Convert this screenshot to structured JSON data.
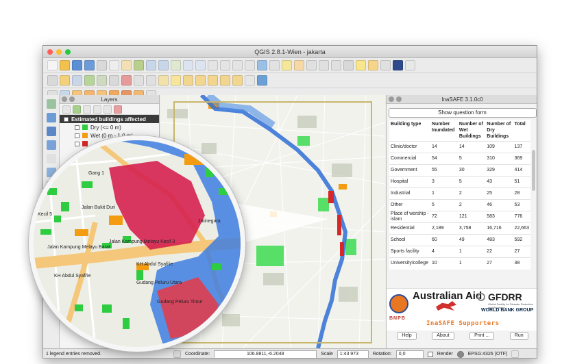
{
  "window": {
    "title": "QGIS 2.8.1-Wien - jakarta"
  },
  "layers_panel": {
    "title": "Layers",
    "group": "Estimated buildings affected",
    "legend": [
      {
        "label": "Dry (<= 0 m)",
        "color": "#2ecc40"
      },
      {
        "label": "Wet (0 m - 1.0 m)",
        "color": "#f39c12"
      },
      {
        "label": "",
        "color": "#d62828"
      }
    ]
  },
  "inasafe": {
    "title": "InaSAFE 3.1.0c0",
    "question_button": "Show question form",
    "columns": [
      "Building type",
      "Number Inundated",
      "Number of Wet Buildings",
      "Number of Dry Buildings",
      "Total"
    ],
    "rows": [
      [
        "Clinic/doctor",
        "14",
        "14",
        "109",
        "137"
      ],
      [
        "Commercial",
        "54",
        "5",
        "310",
        "369"
      ],
      [
        "Government",
        "55",
        "30",
        "329",
        "414"
      ],
      [
        "Hospital",
        "3",
        "5",
        "43",
        "51"
      ],
      [
        "Industrial",
        "1",
        "2",
        "25",
        "28"
      ],
      [
        "Other",
        "5",
        "2",
        "46",
        "53"
      ],
      [
        "Place of worship - islam",
        "72",
        "121",
        "583",
        "776"
      ],
      [
        "Residential",
        "2,189",
        "3,758",
        "16,716",
        "22,663"
      ],
      [
        "School",
        "60",
        "49",
        "483",
        "592"
      ],
      [
        "Sports facility",
        "4",
        "1",
        "22",
        "27"
      ],
      [
        "University/college",
        "10",
        "1",
        "27",
        "38"
      ]
    ],
    "logos": {
      "bnpb": "BNPB",
      "ausaid": "Australian Aid",
      "gfdrr": "GFDRR",
      "gfdrr_sub": "Global Facility for Disaster Reduction and Recovery",
      "worldbank": "WORLD BANK GROUP",
      "supporters": "InaSAFE Supporters"
    },
    "buttons": {
      "help": "Help",
      "about": "About",
      "print": "Print ...",
      "run": "Run"
    }
  },
  "magnifier_labels": {
    "road1": "Jalan Kampung Melayu Barat",
    "road2": "Jalan Kampung Melayu Kecil 3",
    "road3": "KH Abdul Syafi'ie",
    "road4": "Gudang Peluru Utara",
    "road5": "KH Abdul Syafi'ie",
    "road6": "Jatinegara",
    "road7": "Gudang Peluru Timur",
    "road8": "Kecil 5",
    "road9": "Gang 1",
    "road10": "Jalan Bukit Duri"
  },
  "status": {
    "message": "1 legend entries removed.",
    "coordinate_label": "Coordinate:",
    "coordinate": "106.8811,-6.2048",
    "scale_label": "Scale",
    "scale": "1:43 973",
    "rotation_label": "Rotation:",
    "rotation": "0,0",
    "render_label": "Render",
    "crs": "EPSG:4326 (OTF)"
  }
}
